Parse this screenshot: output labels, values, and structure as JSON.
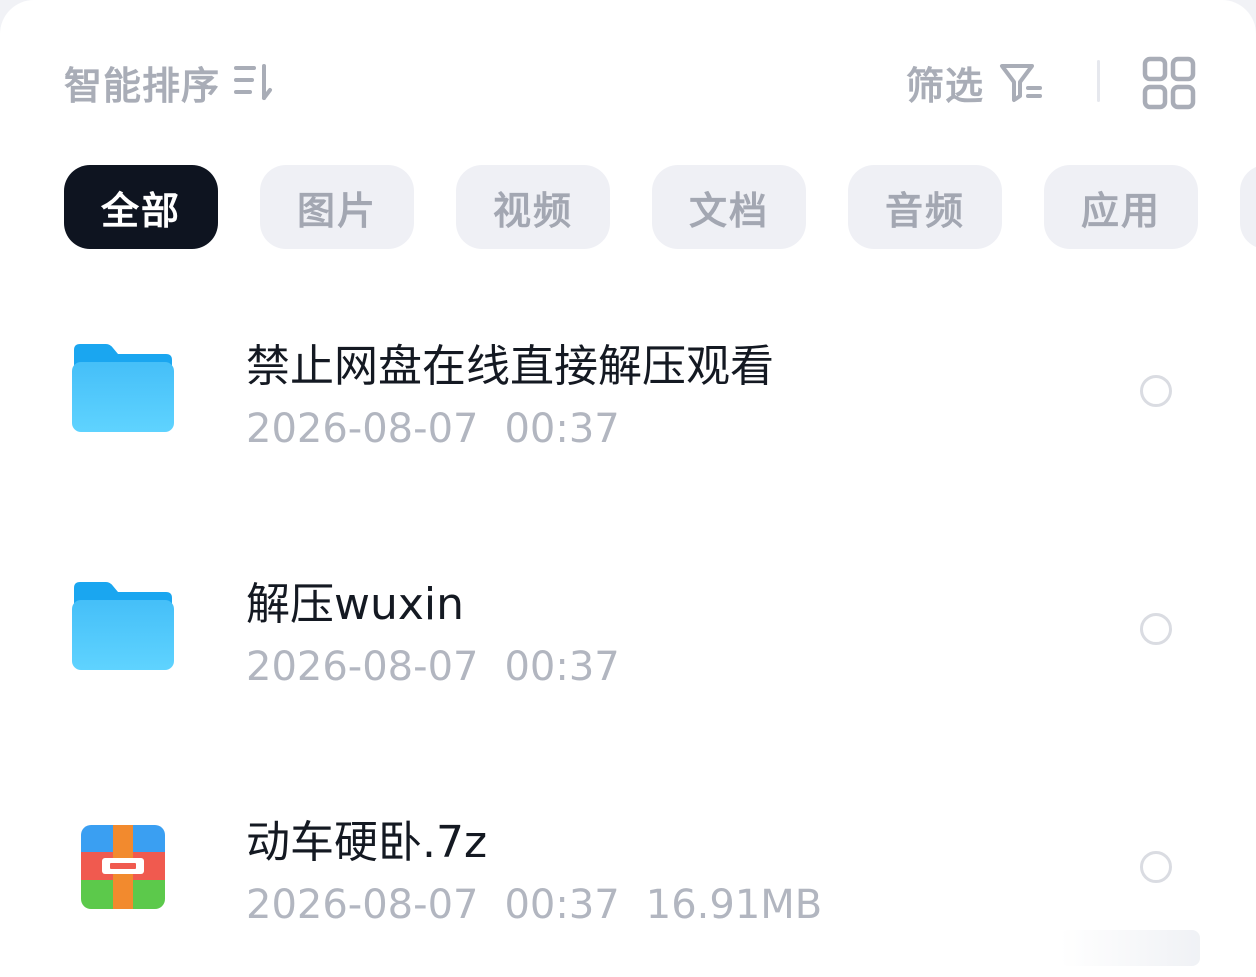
{
  "toolbar": {
    "sort_label": "智能排序",
    "sort_icon": "sort-lines-icon",
    "filter_label": "筛选",
    "filter_icon": "filter-icon",
    "view_toggle_icon": "grid-view-icon"
  },
  "tabs": [
    {
      "label": "全部",
      "active": true
    },
    {
      "label": "图片",
      "active": false
    },
    {
      "label": "视频",
      "active": false
    },
    {
      "label": "文档",
      "active": false
    },
    {
      "label": "音频",
      "active": false
    },
    {
      "label": "应用",
      "active": false
    },
    {
      "label": "",
      "active": false
    }
  ],
  "files": [
    {
      "name": "禁止网盘在线直接解压观看",
      "date": "2026-08-07",
      "time": "00:37",
      "size": "",
      "type": "folder",
      "icon": "folder-icon"
    },
    {
      "name": "解压wuxin",
      "date": "2026-08-07",
      "time": "00:37",
      "size": "",
      "type": "folder",
      "icon": "folder-icon"
    },
    {
      "name": "动车硬卧.7z",
      "date": "2026-08-07",
      "time": "00:37",
      "size": "16.91MB",
      "type": "archive",
      "icon": "archive-icon"
    }
  ],
  "colors": {
    "folder": "#3fb9f6",
    "active_tab": "#0e1420",
    "muted_text": "#a9adb7",
    "archive_blue": "#3a9ff2",
    "archive_red": "#f05a4f",
    "archive_green": "#5cc94b",
    "archive_orange": "#f28a2e"
  }
}
